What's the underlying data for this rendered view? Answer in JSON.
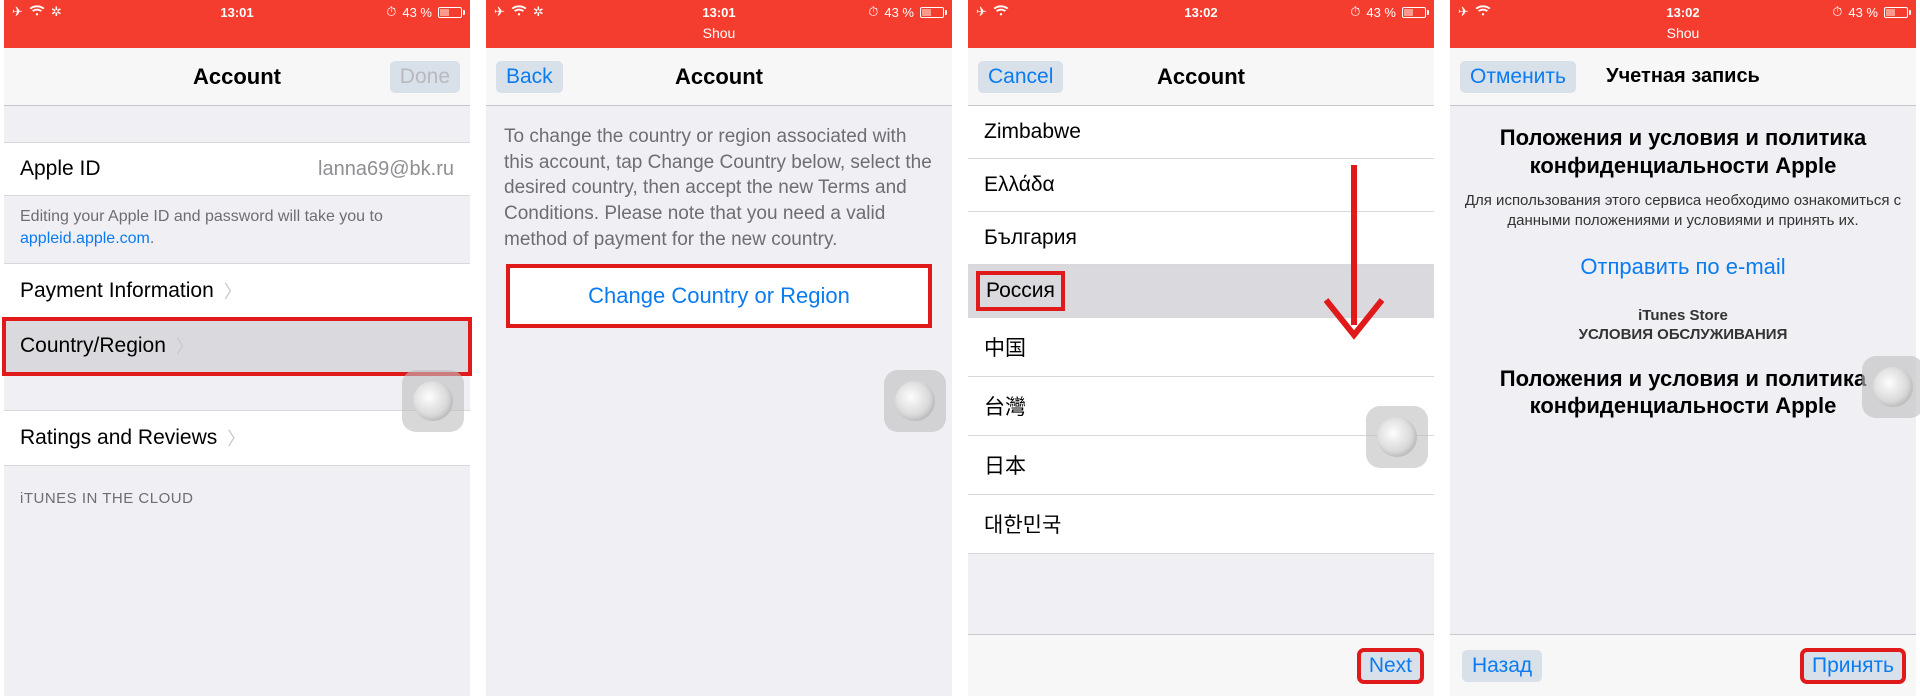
{
  "status": {
    "time1": "13:01",
    "time2": "13:01",
    "time3": "13:02",
    "time4": "13:02",
    "battery_text": "43 %",
    "sub2": "Shou",
    "sub4": "Shou"
  },
  "s1": {
    "nav_title": "Account",
    "done": "Done",
    "apple_id_label": "Apple ID",
    "apple_id_value": "lanna69@bk.ru",
    "edit_note_pre": "Editing your Apple ID and password will take you to ",
    "edit_note_link": "appleid.apple.com",
    "edit_note_post": ".",
    "payment": "Payment Information",
    "country": "Country/Region",
    "ratings": "Ratings and Reviews",
    "cloud_header": "iTUNES IN THE CLOUD"
  },
  "s2": {
    "back": "Back",
    "nav_title": "Account",
    "desc": "To change the country or region associated with this account, tap Change Country below, select the desired country, then accept the new Terms and Conditions. Please note that you need a valid method of payment for the new country.",
    "change": "Change Country or Region"
  },
  "s3": {
    "cancel": "Cancel",
    "nav_title": "Account",
    "countries": [
      "Zimbabwe",
      "Ελλάδα",
      "България",
      "Россия",
      "中国",
      "台灣",
      "日本",
      "대한민국"
    ],
    "selected_index": 3,
    "next": "Next"
  },
  "s4": {
    "cancel": "Отменить",
    "nav_title": "Учетная запись",
    "title1": "Положения и условия и политика конфиденциальности Apple",
    "sub": "Для использования этого сервиса необходимо ознакомиться с данными положениями и условиями и принять их.",
    "email_link": "Отправить по e-mail",
    "store_line1": "iTunes Store",
    "store_line2": "УСЛОВИЯ ОБСЛУЖИВАНИЯ",
    "title2": "Положения и условия и политика конфиденциальности Apple",
    "back": "Назад",
    "accept": "Принять"
  }
}
